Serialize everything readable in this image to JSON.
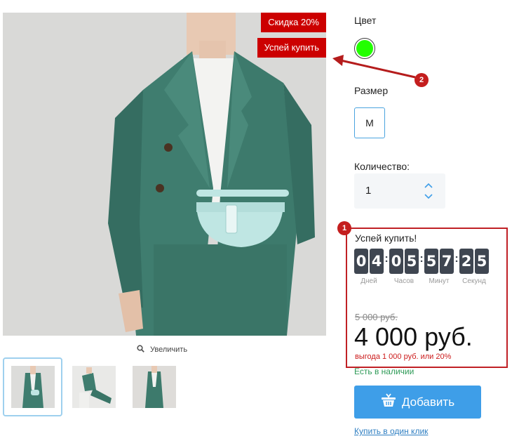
{
  "gallery": {
    "badges": {
      "discount": "Скидка 20%",
      "hurry": "Успей купить"
    },
    "zoom_label": "Увеличить",
    "thumbnails": [
      "thumb-1",
      "thumb-2",
      "thumb-3"
    ]
  },
  "options": {
    "color_label": "Цвет",
    "color_value": "#22ff00",
    "size_label": "Размер",
    "size_value": "M",
    "quantity_label": "Количество:",
    "quantity_value": "1"
  },
  "countdown": {
    "title": "Успей купить!",
    "units": [
      {
        "digits": [
          "0",
          "4"
        ],
        "caption": "Дней"
      },
      {
        "digits": [
          "0",
          "5"
        ],
        "caption": "Часов"
      },
      {
        "digits": [
          "5",
          "7"
        ],
        "caption": "Минут"
      },
      {
        "digits": [
          "2",
          "5"
        ],
        "caption": "Секунд"
      }
    ]
  },
  "pricing": {
    "old_price": "5 000 руб.",
    "price": "4 000 руб.",
    "saving": "выгода 1 000 руб. или 20%"
  },
  "stock_status": "Есть в наличии",
  "actions": {
    "add_label": "Добавить",
    "one_click_label": "Купить в один клик"
  },
  "annotations": {
    "marker_1": "1",
    "marker_2": "2"
  },
  "colors": {
    "accent_red": "#cc0000",
    "button_blue": "#3e9ee8",
    "stock_green": "#2e9a57"
  }
}
